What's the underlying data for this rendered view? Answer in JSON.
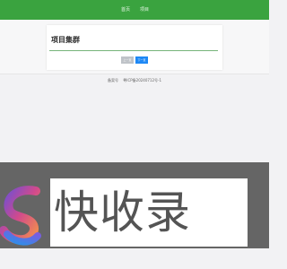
{
  "nav": {
    "items": [
      "首页",
      "项目"
    ]
  },
  "card": {
    "title": "项目集群",
    "prev_button": "上一页",
    "next_button": "下一页"
  },
  "footer": {
    "left": "备案号",
    "right": "粤ICP备20240712号-1"
  },
  "watermark": {
    "text": "快收录"
  },
  "colors": {
    "nav_bg": "#3aa33f",
    "primary_button": "#1e88f5",
    "disabled_button": "#bfc3c8"
  }
}
